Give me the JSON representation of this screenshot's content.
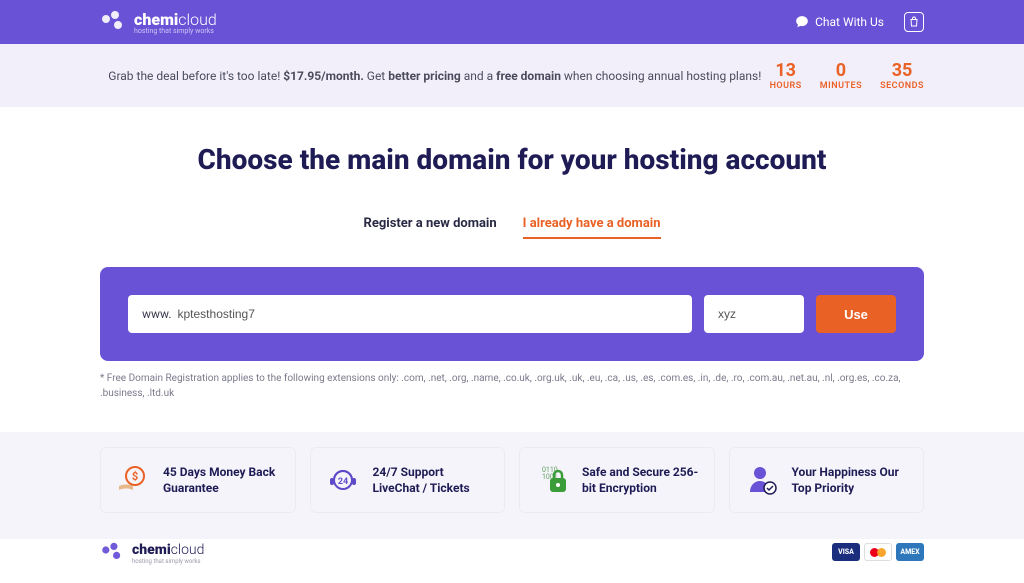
{
  "header": {
    "brand_bold": "chemi",
    "brand_light": "cloud",
    "tagline": "hosting that simply works",
    "chat_label": "Chat With Us"
  },
  "deal": {
    "prefix": "Grab the deal before it's too late! ",
    "price": "$17.95/month.",
    "mid1": " Get ",
    "pricing": "better pricing",
    "mid2": " and a ",
    "domain": "free domain",
    "suffix": " when choosing annual hosting plans!",
    "hours_val": "13",
    "hours_lbl": "HOURS",
    "minutes_val": "0",
    "minutes_lbl": "MINUTES",
    "seconds_val": "35",
    "seconds_lbl": "SECONDS"
  },
  "main": {
    "heading": "Choose the main domain for your hosting account",
    "tab_register": "Register a new domain",
    "tab_existing": "I already have a domain",
    "domain_prefix": "www.",
    "domain_value": "kptesthosting7",
    "tld_value": "xyz",
    "use_label": "Use",
    "disclaimer": "* Free Domain Registration applies to the following extensions only: .com, .net, .org, .name, .co.uk, .org.uk, .uk, .eu, .ca, .us, .es, .com.es, .in, .de, .ro, .com.au, .net.au, .nl, .org.es, .co.za, .business, .ltd.uk"
  },
  "features": [
    {
      "title": "45 Days Money Back Guarantee",
      "icon": "money-back-icon"
    },
    {
      "title": "24/7 Support LiveChat / Tickets",
      "icon": "support-icon"
    },
    {
      "title": "Safe and Secure 256-bit Encryption",
      "icon": "lock-icon"
    },
    {
      "title": "Your Happiness Our Top Priority",
      "icon": "happiness-icon"
    }
  ],
  "footer": {
    "brand_bold": "chemi",
    "brand_light": "cloud",
    "tagline": "hosting that simply works",
    "cards": {
      "visa": "VISA",
      "amex": "AMEX"
    }
  }
}
